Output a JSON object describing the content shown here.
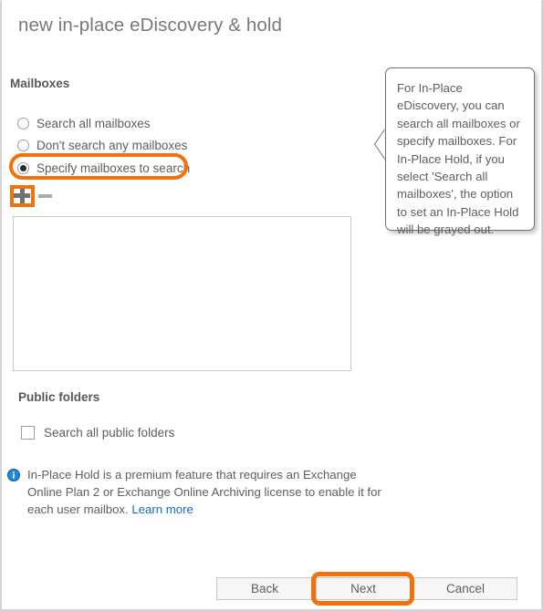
{
  "window": {
    "title": "new in-place eDiscovery & hold",
    "border_color": "#d4d4d4"
  },
  "theme": {
    "highlight_color": "#f3700a",
    "link_color": "#1269c0",
    "text_color": "#5b5f62",
    "heading_color": "#55595c",
    "info_icon_color": "#1e8ad6"
  },
  "mailboxes": {
    "heading": "Mailboxes",
    "options": [
      {
        "label": "Search all mailboxes",
        "selected": false
      },
      {
        "label": "Don't search any mailboxes",
        "selected": false
      },
      {
        "label": "Specify mailboxes to search",
        "selected": true
      }
    ],
    "toolbar": {
      "add_icon": "plus-icon",
      "add_label": "Add",
      "remove_icon": "minus-icon",
      "remove_label": "Remove"
    },
    "list_items": []
  },
  "public_folders": {
    "heading": "Public folders",
    "checkbox": {
      "label": "Search all public folders",
      "checked": false
    }
  },
  "info_note": {
    "icon": "info-icon",
    "text": "In-Place Hold is a premium feature that requires an Exchange Online Plan 2 or Exchange Online Archiving license to enable it for each user mailbox. ",
    "link_label": "Learn more"
  },
  "callout": {
    "text": "For In-Place eDiscovery, you can search all mailboxes or specify mailboxes. For In-Place Hold, if you select 'Search all mailboxes', the option to set an In-Place Hold will be grayed out.",
    "pointer_direction": "left"
  },
  "footer": {
    "back_label": "Back",
    "next_label": "Next",
    "cancel_label": "Cancel"
  }
}
